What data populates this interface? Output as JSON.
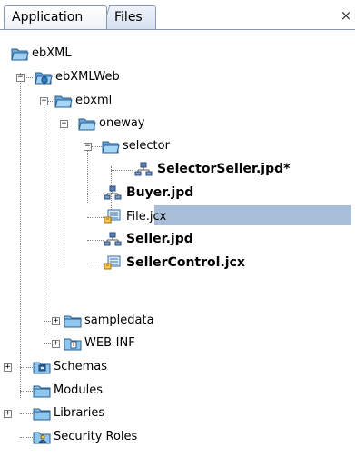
{
  "tabs": [
    {
      "label": "Application",
      "active": true
    },
    {
      "label": "Files",
      "active": false
    }
  ],
  "close_label": "×",
  "tree": [
    {
      "id": "ebxml",
      "label": "ebXML",
      "icon": "project-folder-icon",
      "toggle": "",
      "bold": false
    },
    {
      "id": "ebxmlweb",
      "label": "ebXMLWeb",
      "icon": "web-project-folder-icon",
      "toggle": "−",
      "bold": false
    },
    {
      "id": "ebxml-folder",
      "label": "ebxml",
      "icon": "folder-open-icon",
      "toggle": "−",
      "bold": false
    },
    {
      "id": "oneway",
      "label": "oneway",
      "icon": "folder-open-icon",
      "toggle": "−",
      "bold": false
    },
    {
      "id": "selector",
      "label": "selector",
      "icon": "folder-open-icon",
      "toggle": "−",
      "bold": false
    },
    {
      "id": "selectorseller",
      "label": "SelectorSeller.jpd*",
      "icon": "process-jpd-icon",
      "toggle": "",
      "bold": true,
      "selected": true
    },
    {
      "id": "buyer",
      "label": "Buyer.jpd",
      "icon": "process-jpd-icon",
      "toggle": "",
      "bold": true
    },
    {
      "id": "file",
      "label": "File.jcx",
      "icon": "control-jcx-icon",
      "toggle": "",
      "bold": false
    },
    {
      "id": "seller",
      "label": "Seller.jpd",
      "icon": "process-jpd-icon",
      "toggle": "",
      "bold": true
    },
    {
      "id": "sellercontrol",
      "label": "SellerControl.jcx",
      "icon": "control-jcx-icon",
      "toggle": "",
      "bold": true
    },
    {
      "id": "sampledata",
      "label": "sampledata",
      "icon": "folder-closed-icon",
      "toggle": "+",
      "bold": false
    },
    {
      "id": "webinf",
      "label": "WEB-INF",
      "icon": "web-inf-folder-icon",
      "toggle": "+",
      "bold": false
    },
    {
      "id": "schemas",
      "label": "Schemas",
      "icon": "schemas-folder-icon",
      "toggle": "+",
      "bold": false
    },
    {
      "id": "modules",
      "label": "Modules",
      "icon": "folder-closed-icon",
      "toggle": "",
      "bold": false
    },
    {
      "id": "libraries",
      "label": "Libraries",
      "icon": "folder-closed-icon",
      "toggle": "+",
      "bold": false
    },
    {
      "id": "securityroles",
      "label": "Security Roles",
      "icon": "security-roles-folder-icon",
      "toggle": "",
      "bold": false
    }
  ]
}
